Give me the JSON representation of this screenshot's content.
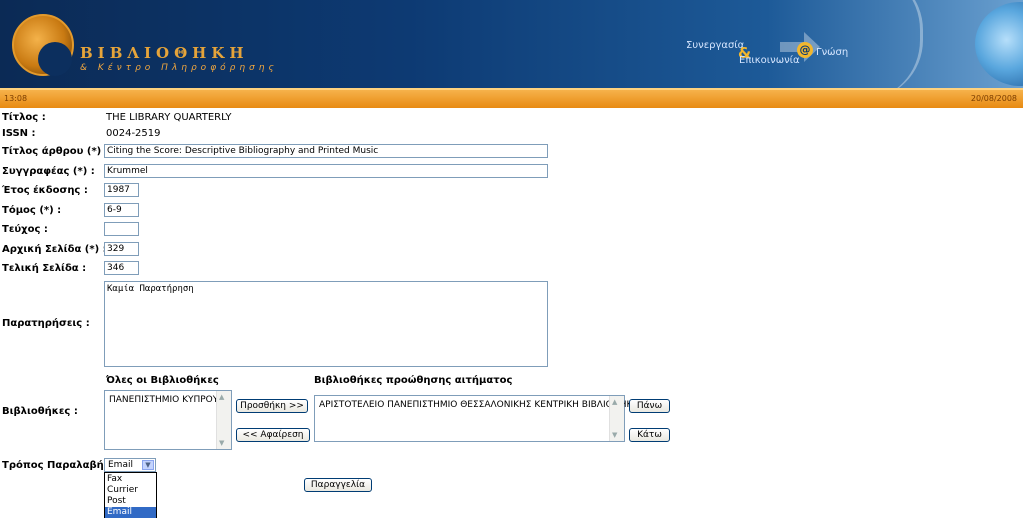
{
  "header": {
    "logo_title": "ΒΙΒΛΙΟΘΗΚΗ",
    "logo_subtitle": "& Κέντρο Πληροφόρησης",
    "slogan": {
      "part1": "Συνεργασία",
      "amp": "&",
      "part2": "Επικοινωνία",
      "at": "@",
      "part3": "Γνώση"
    }
  },
  "status_bar": {
    "time": "13:08",
    "date": "20/08/2008"
  },
  "form": {
    "title": {
      "label": "Τίτλος :",
      "value": "THE LIBRARY QUARTERLY"
    },
    "issn": {
      "label": "ISSN :",
      "value": "0024-2519"
    },
    "article_title": {
      "label": "Τίτλος άρθρου (*) :",
      "value": "Citing the Score: Descriptive Bibliography and Printed Music"
    },
    "authors": {
      "label": "Συγγραφέας (*) :",
      "value": "Krummel"
    },
    "year": {
      "label": "Έτος έκδοσης :",
      "value": "1987"
    },
    "volume": {
      "label": "Τόμος (*) :",
      "value": "6-9"
    },
    "issue": {
      "label": "Τεύχος :",
      "value": ""
    },
    "start_page": {
      "label": "Αρχική Σελίδα (*) :",
      "value": "329"
    },
    "end_page": {
      "label": "Τελική Σελίδα :",
      "value": "346"
    },
    "remarks": {
      "label": "Παρατηρήσεις :",
      "value": "Καμία Παρατήρηση"
    },
    "libraries": {
      "label": "Βιβλιοθήκες :",
      "all_title": "Όλες οι Βιβλιοθήκες",
      "all_items": [
        "ΠΑΝΕΠΙΣΤΗΜΙΟ ΚΥΠΡΟΥ"
      ],
      "selected_title": "Βιβλιοθήκες προώθησης αιτήματος",
      "selected_items": [
        "ΑΡΙΣΤΟΤΕΛΕΙΟ ΠΑΝΕΠΙΣΤΗΜΙΟ ΘΕΣΣΑΛΟΝΙΚΗΣ ΚΕΝΤΡΙΚΗ ΒΙΒΛΙΟΘΗΚΗ"
      ],
      "add_button": "Προσθήκη >>",
      "remove_button": "<< Αφαίρεση",
      "up_button": "Πάνω",
      "down_button": "Κάτω"
    },
    "delivery": {
      "label": "Τρόπος Παραλαβής :",
      "selected": "Email",
      "options": [
        "Fax",
        "Currier",
        "Post",
        "Email"
      ]
    },
    "order_button": "Παραγγελία"
  },
  "colors": {
    "header_dark": "#0b2a55",
    "accent_orange": "#e88a12",
    "selection_blue": "#316ac5"
  }
}
